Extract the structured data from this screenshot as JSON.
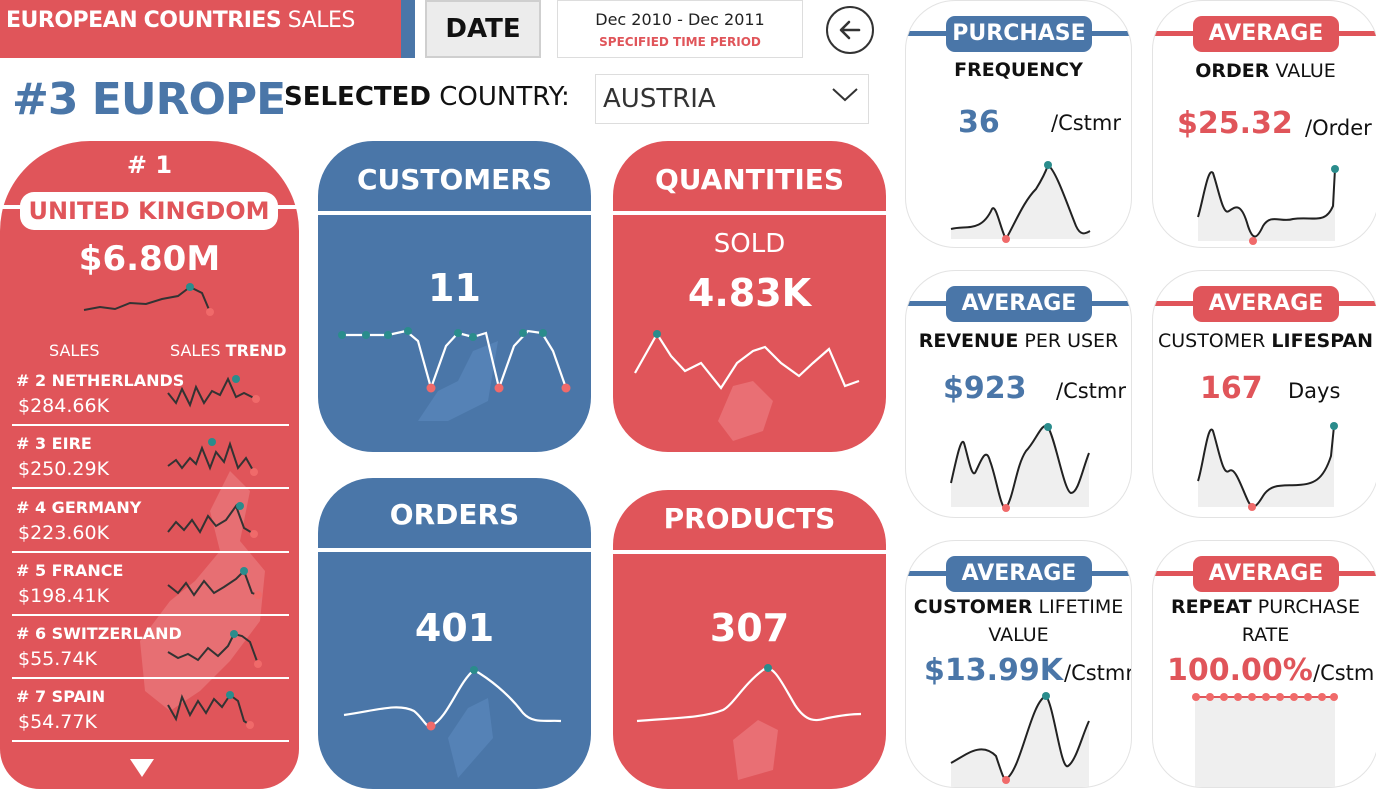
{
  "header": {
    "title_bold": "EUROPEAN",
    "title_red": "COUNTRIES",
    "title_light": "SALES",
    "date_button": "DATE",
    "date_range": "Dec 2010 - Dec 2011",
    "date_caption": "SPECIFIED TIME PERIOD",
    "back_icon": "back-arrow-icon"
  },
  "selection": {
    "rank_title": "#3 EUROPE",
    "label_bold": "SELECTED",
    "label_light": "COUNTRY:",
    "country": "AUSTRIA"
  },
  "top_country": {
    "rank": "# 1",
    "name": "UNITED KINGDOM",
    "sales": "$6.80M"
  },
  "country_list": {
    "col_sales": "SALES",
    "col_trend_light": "SALES",
    "col_trend_bold": "TREND",
    "rows": [
      {
        "name": "# 2 NETHERLANDS",
        "sales": "$284.66K"
      },
      {
        "name": "# 3 EIRE",
        "sales": "$250.29K"
      },
      {
        "name": "# 4 GERMANY",
        "sales": "$223.60K"
      },
      {
        "name": "# 5 FRANCE",
        "sales": "$198.41K"
      },
      {
        "name": "# 6 SWITZERLAND",
        "sales": "$55.74K"
      },
      {
        "name": "# 7 SPAIN",
        "sales": "$54.77K"
      }
    ]
  },
  "cards": {
    "customers": {
      "title": "CUSTOMERS",
      "value": "11"
    },
    "quantities": {
      "title": "QUANTITIES",
      "subtitle": "SOLD",
      "value": "4.83K"
    },
    "orders": {
      "title": "ORDERS",
      "value": "401"
    },
    "products": {
      "title": "PRODUCTS",
      "value": "307"
    }
  },
  "kpis": {
    "purchase_frequency": {
      "badge": "PURCHASE",
      "label_bold": "FREQUENCY",
      "value": "36",
      "unit": "/Cstmr"
    },
    "avg_order_value": {
      "badge": "AVERAGE",
      "label_bold": "ORDER",
      "label_light": "VALUE",
      "value": "$25.32",
      "unit": "/Order"
    },
    "avg_revenue_per_user": {
      "badge": "AVERAGE",
      "label_bold": "REVENUE",
      "label_light": "PER USER",
      "value": "$923",
      "unit": "/Cstmr"
    },
    "avg_customer_lifespan": {
      "badge": "AVERAGE",
      "label_light": "CUSTOMER",
      "label_bold": "LIFESPAN",
      "value": "167",
      "unit": "Days"
    },
    "avg_customer_lifetime_value": {
      "badge": "AVERAGE",
      "label_bold": "CUSTOMER",
      "label_light": "LIFETIME",
      "label_line2": "VALUE",
      "value": "$13.99K",
      "unit": "/Cstmr"
    },
    "avg_repeat_purchase_rate": {
      "badge": "AVERAGE",
      "label_bold": "REPEAT",
      "label_light": "PURCHASE",
      "label_line2": "RATE",
      "value": "100.00%",
      "unit": "/Cstmr"
    }
  },
  "colors": {
    "red": "#E0555A",
    "blue": "#4A76A8",
    "teal": "#2A8C8C"
  }
}
